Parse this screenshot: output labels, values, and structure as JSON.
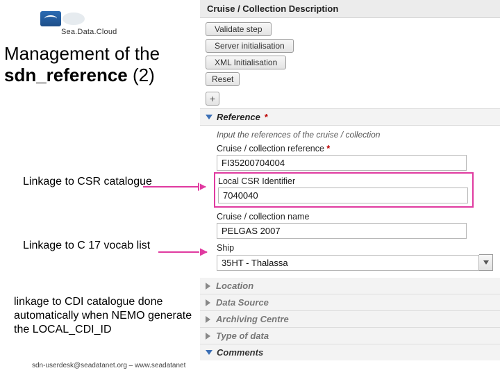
{
  "logo": {
    "text": "Sea.Data.Cloud"
  },
  "title_line1": "Management of the",
  "title_line2_bold": "sdn_reference",
  "title_line2_rest": " (2)",
  "annotations": {
    "a1": "Linkage to CSR catalogue",
    "a2": "Linkage to C 17 vocab list",
    "a3": "linkage to CDI catalogue done automatically when NEMO generate the LOCAL_CDI_ID"
  },
  "footer": "sdn-userdesk@seadatanet.org – www.seadatanet",
  "panel": {
    "title": "Cruise / Collection Description",
    "buttons": {
      "validate": "Validate step",
      "serverInit": "Server initialisation",
      "xmlInit": "XML Initialisation",
      "reset": "Reset",
      "plus": "+"
    },
    "reference": {
      "heading": "Reference",
      "helper": "Input the references of the cruise / collection",
      "labels": {
        "cruiseRef": "Cruise / collection reference",
        "localCsrId": "Local CSR Identifier",
        "cruiseName": "Cruise / collection name",
        "ship": "Ship"
      },
      "values": {
        "cruiseRef": "FI35200704004",
        "localCsrId": "7040040",
        "cruiseName": "PELGAS 2007",
        "ship": "35HT - Thalassa"
      }
    },
    "collapsed": {
      "location": "Location",
      "dataSource": "Data Source",
      "archivingCentre": "Archiving Centre",
      "typeOfData": "Type of data"
    },
    "comments": "Comments"
  }
}
